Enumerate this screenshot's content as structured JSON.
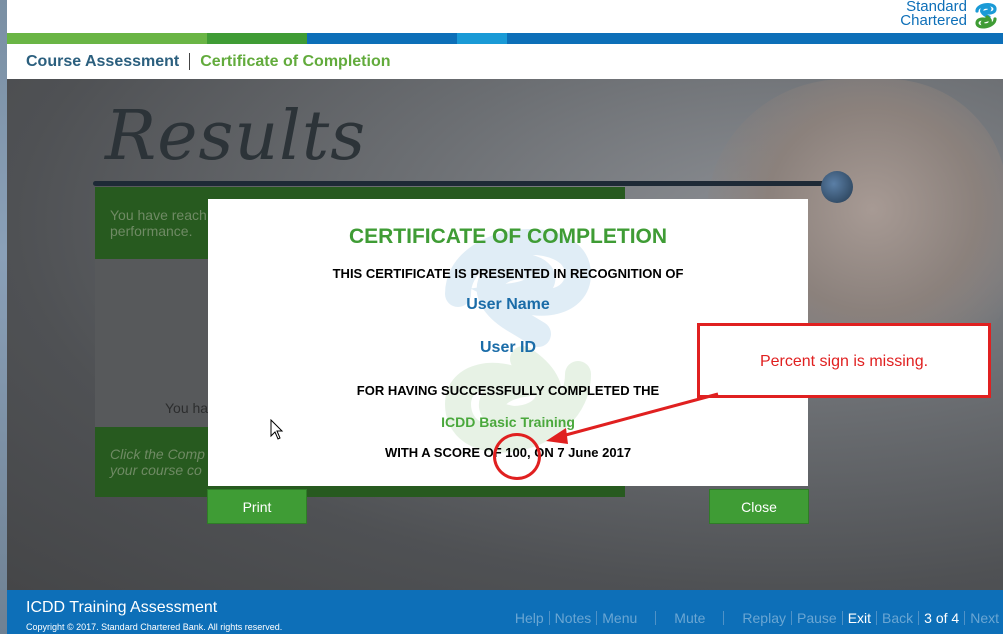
{
  "header": {
    "brand_line1": "Standard",
    "brand_line2": "Chartered",
    "logo_icon": "standard-chartered-logo-icon"
  },
  "breadcrumb": {
    "item1": "Course Assessment",
    "item2": "Certificate of Completion"
  },
  "stripe_colors": [
    "#62ab3c",
    "#3f9c35",
    "#0d6fb8",
    "#1a9ad6",
    "#0d6fb8"
  ],
  "background": {
    "title": "Results",
    "panel_top_text": "You have reach\nperformance.",
    "panel_mid_text": "You ha",
    "panel_bottom_text": "Click the Comp\nyour course co"
  },
  "certificate": {
    "title": "CERTIFICATE OF COMPLETION",
    "presented_line": "THIS CERTIFICATE IS PRESENTED IN RECOGNITION OF",
    "user_name": "User Name",
    "user_id": "User ID",
    "completed_line": "FOR HAVING SUCCESSFULLY COMPLETED THE",
    "course_name": "ICDD Basic Training",
    "score_line": "WITH A SCORE OF 100, ON 7 June 2017",
    "print_label": "Print",
    "close_label": "Close"
  },
  "annotation": {
    "callout_text": "Percent sign is missing.",
    "color": "#e02020"
  },
  "footer": {
    "course_title": "ICDD Training Assessment",
    "copyright": "Copyright © 2017. Standard Chartered Bank. All rights reserved.",
    "nav": {
      "help": "Help",
      "notes": "Notes",
      "menu": "Menu",
      "mute": "Mute",
      "replay": "Replay",
      "pause": "Pause",
      "exit": "Exit",
      "back": "Back",
      "page": "3 of 4",
      "next": "Next"
    }
  },
  "colors": {
    "brand_blue": "#0d6fb8",
    "brand_green": "#3f9c35",
    "annotation_red": "#e02020"
  }
}
